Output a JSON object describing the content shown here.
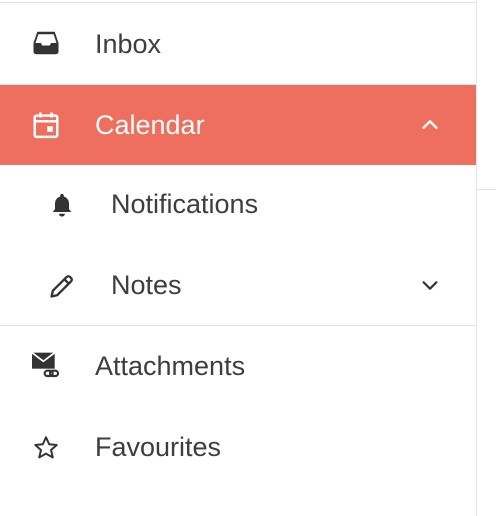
{
  "menu": {
    "items": [
      {
        "label": "Inbox",
        "icon": "inbox-icon"
      },
      {
        "label": "Calendar",
        "icon": "calendar-icon",
        "expanded": true,
        "active": true
      },
      {
        "label": "Notifications",
        "icon": "bell-icon",
        "sub": true
      },
      {
        "label": "Notes",
        "icon": "pencil-icon",
        "sub": true,
        "expanded": false
      },
      {
        "label": "Attachments",
        "icon": "mail-attachment-icon"
      },
      {
        "label": "Favourites",
        "icon": "star-outline-icon"
      }
    ]
  },
  "colors": {
    "active_bg": "#ef6f5f",
    "text": "#3d3d3d",
    "active_text": "#ffffff",
    "divider": "#e3e3e3"
  }
}
